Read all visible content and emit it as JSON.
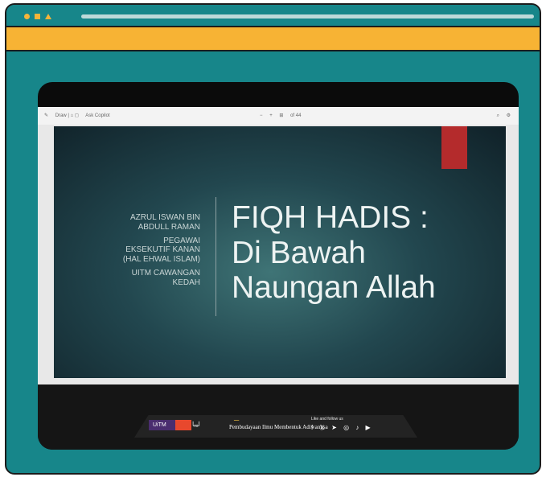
{
  "toolbar": {
    "draw": "Draw",
    "ask_copilot": "Ask Copilot",
    "page_of": "of 44"
  },
  "slide": {
    "left_blocks": [
      "AZRUL ISWAN BIN ABDULL RAMAN",
      "PEGAWAI EKSEKUTIF KANAN (HAL EHWAL ISLAM)",
      "UITM CAWANGAN KEDAH"
    ],
    "title_lines": [
      "FIQH HADIS :",
      "Di Bawah",
      "Naungan Allah"
    ]
  },
  "footer": {
    "follow_text": "Like and follow us",
    "gold_text": "Pembudayaan Ilmu Membentuk Adiwangsa"
  },
  "icons": [
    "close-icon",
    "draw-icon",
    "facebook-icon",
    "x-icon",
    "telegram-icon",
    "instagram-icon",
    "tiktok-icon",
    "youtube-icon"
  ],
  "colors": {
    "window_bg": "#17868a",
    "accent_orange": "#f7b334",
    "slide_red": "#b42b2c"
  }
}
